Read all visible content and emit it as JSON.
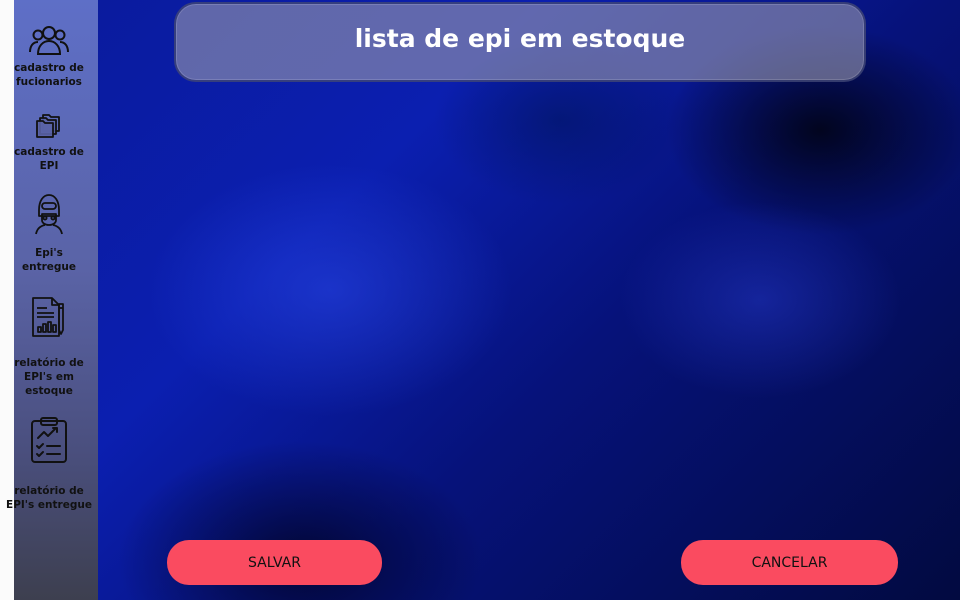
{
  "header": {
    "title": "lista de epi em estoque"
  },
  "sidebar": {
    "items": [
      {
        "label": "cadastro de fucionarios",
        "icon": "users-group-icon"
      },
      {
        "label": "cadastro de EPI",
        "icon": "folders-icon"
      },
      {
        "label": "Epi's entregue",
        "icon": "ppe-mask-person-icon"
      },
      {
        "label": "relatório de EPI's em estoque",
        "icon": "report-chart-pen-icon"
      },
      {
        "label": "relatório de EPI's entregue",
        "icon": "clipboard-checklist-icon"
      }
    ]
  },
  "actions": {
    "save_label": "SALVAR",
    "cancel_label": "CANCELAR"
  },
  "colors": {
    "accent_button": "#fa4b60",
    "background": "#0b1fb0",
    "sidebar": "#5a63a6"
  }
}
